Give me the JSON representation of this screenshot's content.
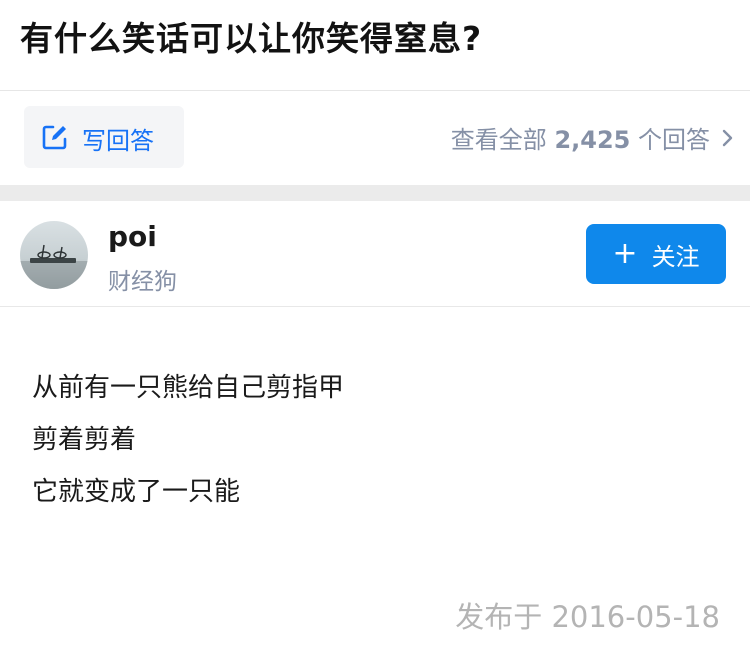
{
  "question": {
    "title": "有什么笑话可以让你笑得窒息?"
  },
  "toolbar": {
    "write_answer_label": "写回答",
    "view_all_prefix": "查看全部 ",
    "answer_count": "2,425",
    "view_all_suffix": " 个回答"
  },
  "author": {
    "name": "poi",
    "tagline": "财经狗",
    "follow_label": "关注"
  },
  "answer": {
    "lines": [
      "从前有一只熊给自己剪指甲",
      "剪着剪着",
      "它就变成了一只能"
    ],
    "published": "发布于 2016-05-18"
  },
  "colors": {
    "accent": "#0f88eb",
    "link": "#1772f6",
    "muted": "#8590a6"
  },
  "icons": {
    "write": "edit-icon",
    "view_all": "chevron-right-icon",
    "follow": "plus-icon"
  }
}
